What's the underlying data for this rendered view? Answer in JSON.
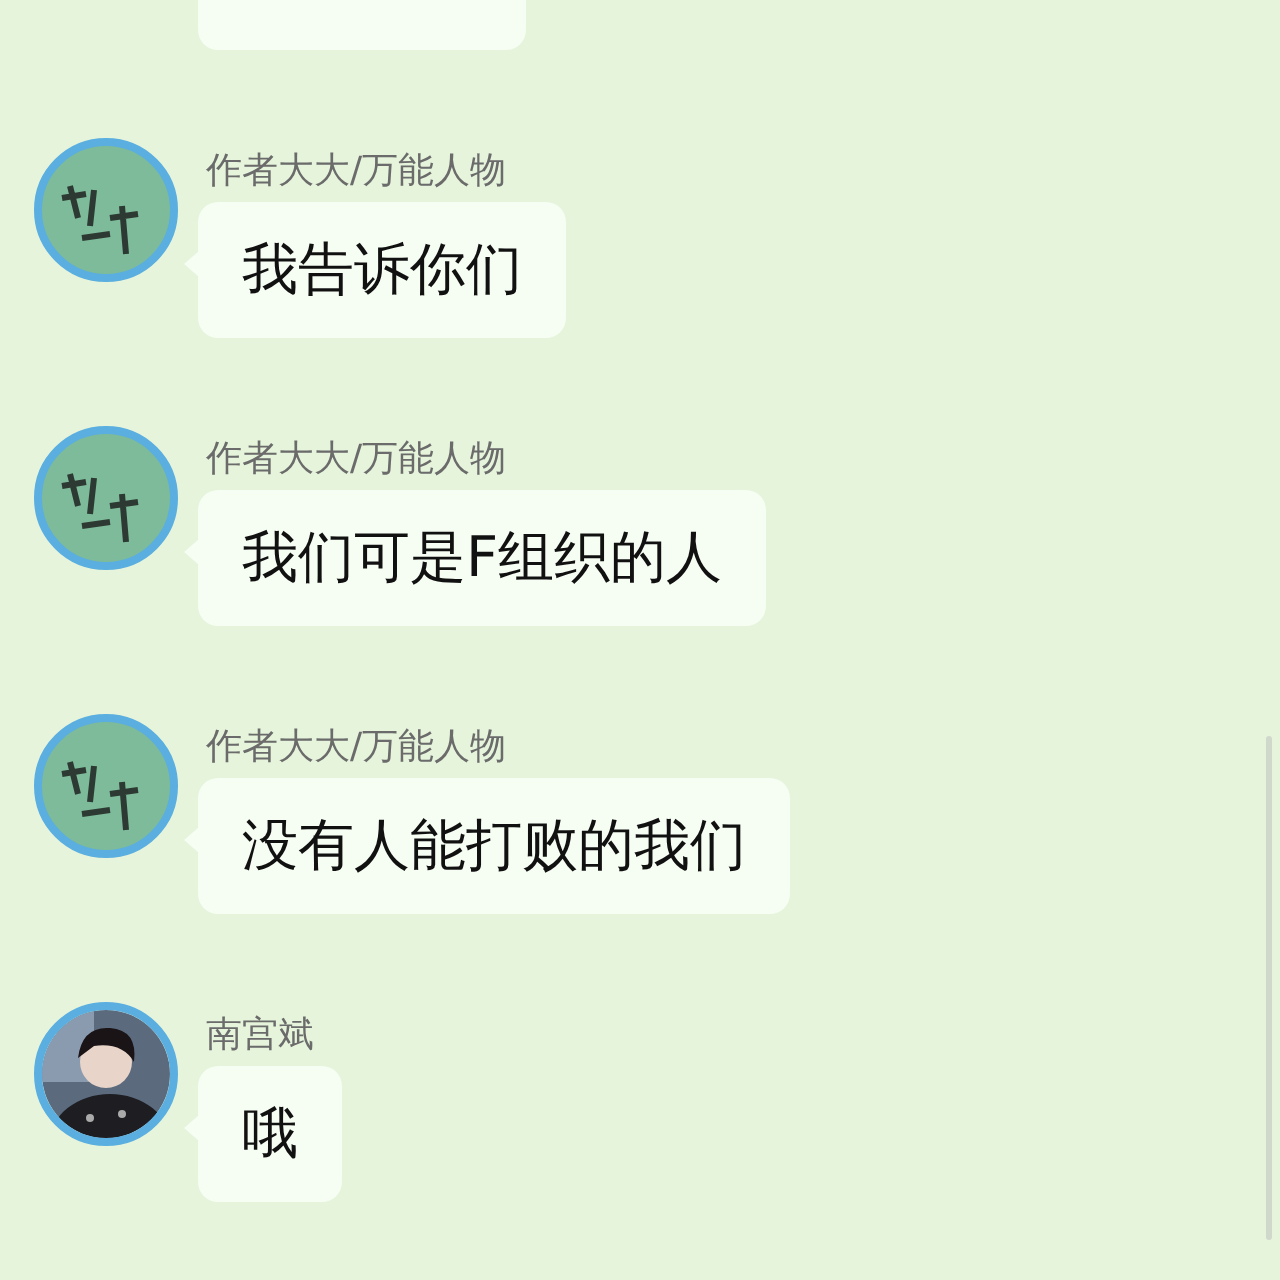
{
  "messages": [
    {
      "kind": "partial"
    },
    {
      "kind": "drawn_avatar",
      "sender": "作者大大/万能人物",
      "text": "我告诉你们"
    },
    {
      "kind": "drawn_avatar",
      "sender": "作者大大/万能人物",
      "text": "我们可是F组织的人"
    },
    {
      "kind": "drawn_avatar",
      "sender": "作者大大/万能人物",
      "text": "没有人能打败的我们"
    },
    {
      "kind": "photo_avatar",
      "sender": "南宫斌",
      "text": "哦"
    }
  ]
}
